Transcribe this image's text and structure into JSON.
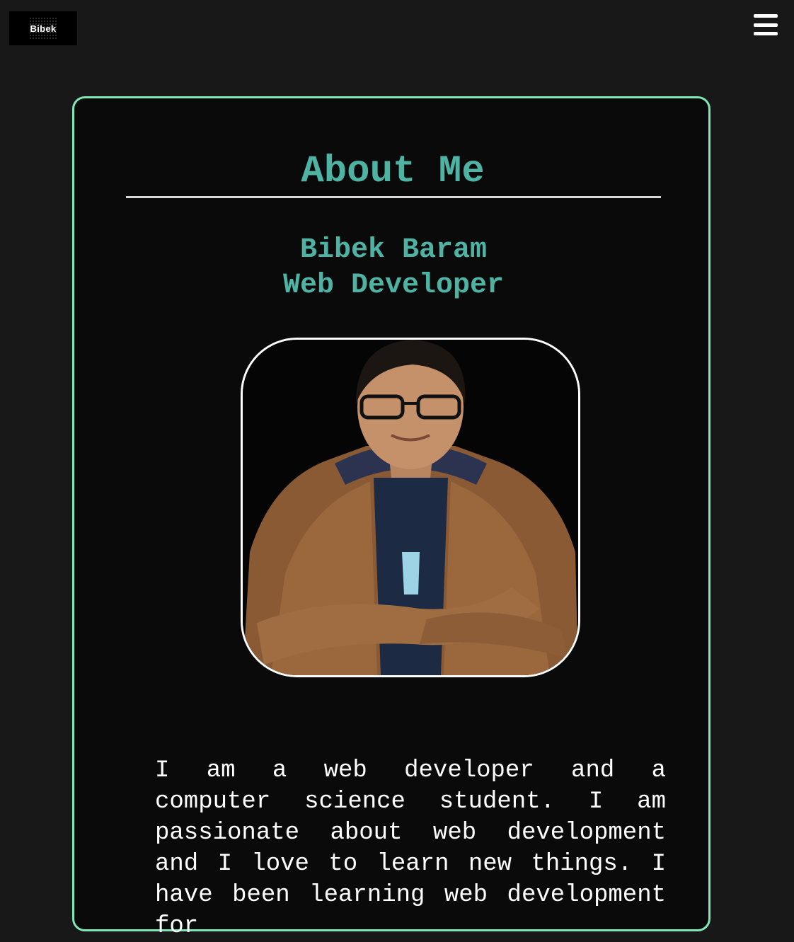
{
  "header": {
    "logo_text": "Bibek"
  },
  "about": {
    "heading": "About Me",
    "name": "Bibek Baram",
    "role": "Web Developer",
    "photo_alt": "Bibek Baram",
    "bio": "I am a web developer and a computer science student. I am passionate about web development and I love to learn new things. I have been learning web development for"
  },
  "colors": {
    "page_bg": "#181818",
    "card_bg": "#0a0a0a",
    "card_border": "#7ee8b8",
    "accent_text": "#4fb3a4",
    "body_text": "#ffffff"
  }
}
